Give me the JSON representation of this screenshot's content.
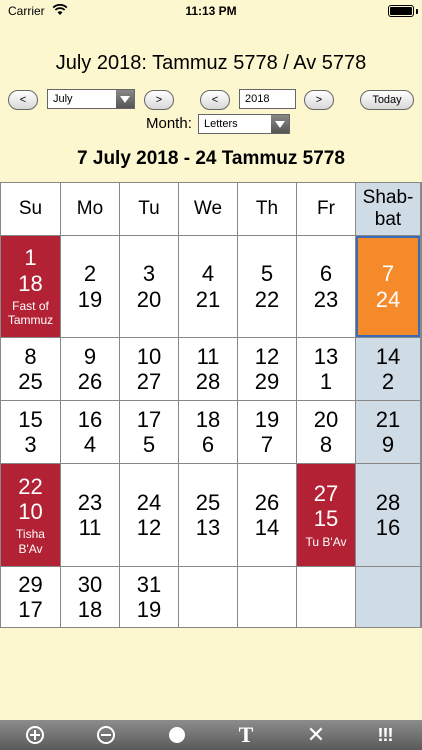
{
  "status": {
    "carrier": "Carrier",
    "time": "11:13 PM"
  },
  "header": {
    "title": "July 2018:    Tammuz 5778 / Av 5778"
  },
  "controls": {
    "prev_month": "<",
    "month_value": "July",
    "next_month": ">",
    "prev_year": "<",
    "year_value": "2018",
    "next_year": ">",
    "today": "Today",
    "month_label": "Month:",
    "month_mode": "Letters"
  },
  "date_heading": "7 July 2018 - 24 Tammuz 5778",
  "calendar": {
    "weekdays": [
      "Su",
      "Mo",
      "Tu",
      "We",
      "Th",
      "Fr"
    ],
    "shabbat_header": [
      "Shab-",
      "bat"
    ],
    "weeks": [
      [
        {
          "g": "1",
          "h": "18",
          "holiday": [
            "Fast of",
            "Tammuz"
          ]
        },
        {
          "g": "2",
          "h": "19"
        },
        {
          "g": "3",
          "h": "20"
        },
        {
          "g": "4",
          "h": "21"
        },
        {
          "g": "5",
          "h": "22"
        },
        {
          "g": "6",
          "h": "23"
        },
        {
          "g": "7",
          "h": "24",
          "today": true
        }
      ],
      [
        {
          "g": "8",
          "h": "25"
        },
        {
          "g": "9",
          "h": "26"
        },
        {
          "g": "10",
          "h": "27"
        },
        {
          "g": "11",
          "h": "28"
        },
        {
          "g": "12",
          "h": "29"
        },
        {
          "g": "13",
          "h": "1"
        },
        {
          "g": "14",
          "h": "2"
        }
      ],
      [
        {
          "g": "15",
          "h": "3"
        },
        {
          "g": "16",
          "h": "4"
        },
        {
          "g": "17",
          "h": "5"
        },
        {
          "g": "18",
          "h": "6"
        },
        {
          "g": "19",
          "h": "7"
        },
        {
          "g": "20",
          "h": "8"
        },
        {
          "g": "21",
          "h": "9"
        }
      ],
      [
        {
          "g": "22",
          "h": "10",
          "holiday": [
            "Tisha",
            "B'Av"
          ]
        },
        {
          "g": "23",
          "h": "11"
        },
        {
          "g": "24",
          "h": "12"
        },
        {
          "g": "25",
          "h": "13"
        },
        {
          "g": "26",
          "h": "14"
        },
        {
          "g": "27",
          "h": "15",
          "holiday": [
            "Tu B'Av"
          ]
        },
        {
          "g": "28",
          "h": "16"
        }
      ],
      [
        {
          "g": "29",
          "h": "17"
        },
        {
          "g": "30",
          "h": "18"
        },
        {
          "g": "31",
          "h": "19"
        },
        {
          "g": "",
          "h": ""
        },
        {
          "g": "",
          "h": ""
        },
        {
          "g": "",
          "h": ""
        },
        {
          "g": "",
          "h": ""
        }
      ]
    ]
  },
  "toolbar": {
    "items": [
      "add-icon",
      "remove-icon",
      "dot-icon",
      "text-icon",
      "close-icon",
      "alert-icon"
    ],
    "text_glyph": "T",
    "close_glyph": "✕",
    "alert_glyph": "!!!"
  },
  "colors": {
    "holiday": "#b22234",
    "today": "#f58a2b",
    "shabbat": "#cfdbe5",
    "background": "#fdf7d0"
  }
}
